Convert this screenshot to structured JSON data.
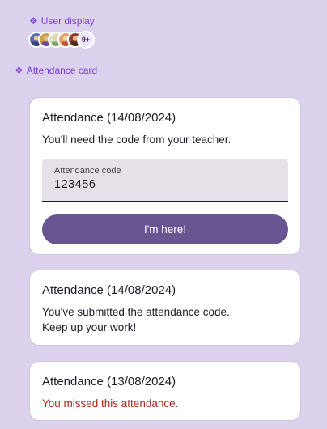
{
  "sections": {
    "user_display_label": "User display",
    "attendance_card_label": "Attendance card"
  },
  "avatars": {
    "count_badge": "9+"
  },
  "cards": [
    {
      "title": "Attendance (14/08/2024)",
      "message": "You'll need the code from your teacher.",
      "field_label": "Attendance code",
      "field_value": "123456",
      "button_label": "I'm here!"
    },
    {
      "title": "Attendance (14/08/2024)",
      "message_line1": "You've submitted the attendance code.",
      "message_line2": "Keep up your work!"
    },
    {
      "title": "Attendance (13/08/2024)",
      "message": "You missed this attendance."
    }
  ],
  "colors": {
    "background": "#ddd2ee",
    "accent_label": "#7b3fd6",
    "button": "#6a5593",
    "missed_text": "#b3261e"
  }
}
